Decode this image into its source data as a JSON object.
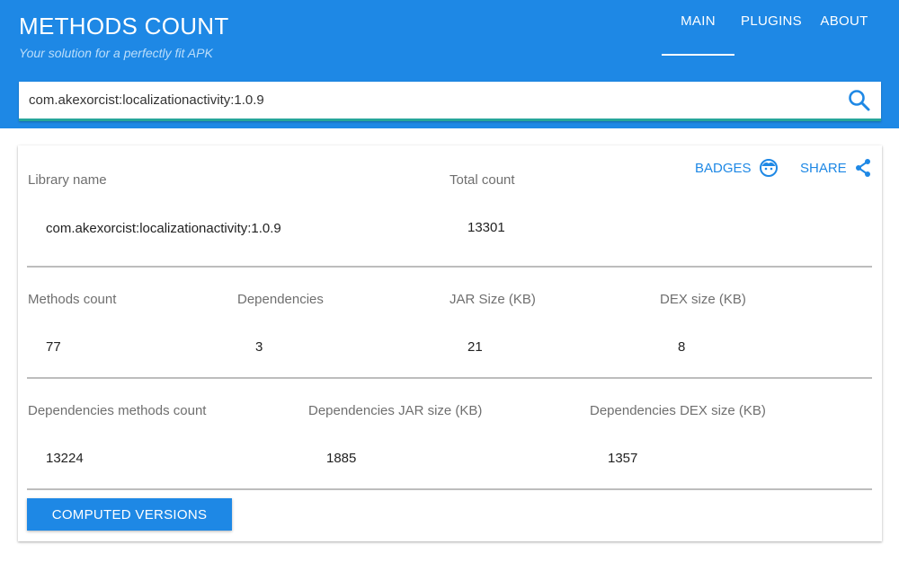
{
  "header": {
    "title": "METHODS COUNT",
    "tagline": "Your solution for a perfectly fit APK",
    "nav": [
      "MAIN",
      "PLUGINS",
      "ABOUT"
    ],
    "active_tab": "MAIN"
  },
  "search": {
    "value": "com.akexorcist:localizationactivity:1.0.9",
    "icon": "search-icon"
  },
  "card": {
    "actions": {
      "badges_label": "BADGES",
      "badges_icon": "face-icon",
      "share_label": "SHARE",
      "share_icon": "share-icon"
    },
    "library_name_label": "Library name",
    "library_name_value": "com.akexorcist:localizationactivity:1.0.9",
    "total_count_label": "Total count",
    "total_count_value": "13301",
    "methods_count_label": "Methods count",
    "methods_count_value": "77",
    "dependencies_label": "Dependencies",
    "dependencies_value": "3",
    "jar_size_label": "JAR Size (KB)",
    "jar_size_value": "21",
    "dex_size_label": "DEX size (KB)",
    "dex_size_value": "8",
    "dep_methods_label": "Dependencies methods count",
    "dep_methods_value": "13224",
    "dep_jar_label": "Dependencies JAR size (KB)",
    "dep_jar_value": "1885",
    "dep_dex_label": "Dependencies DEX size (KB)",
    "dep_dex_value": "1357",
    "computed_versions_label": "COMPUTED VERSIONS"
  },
  "colors": {
    "primary": "#1e88e5",
    "input_underline": "#26a69a"
  }
}
